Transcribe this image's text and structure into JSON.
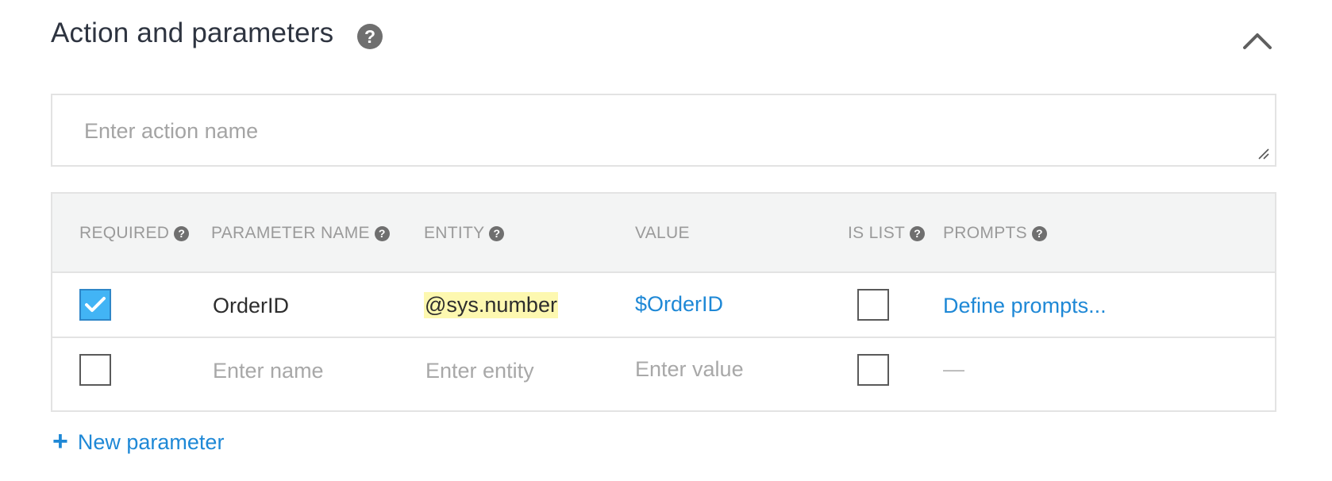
{
  "section": {
    "title": "Action and parameters",
    "help_icon": "?"
  },
  "action_input": {
    "placeholder": "Enter action name",
    "value": ""
  },
  "table": {
    "headers": {
      "required": "REQUIRED",
      "parameter_name": "PARAMETER NAME",
      "entity": "ENTITY",
      "value": "VALUE",
      "is_list": "IS LIST",
      "prompts": "PROMPTS"
    },
    "rows": [
      {
        "required": true,
        "parameter_name": "OrderID",
        "entity": "@sys.number",
        "value": "$OrderID",
        "is_list": false,
        "prompts": "Define prompts..."
      },
      {
        "required": false,
        "parameter_name_placeholder": "Enter name",
        "entity_placeholder": "Enter entity",
        "value_placeholder": "Enter value",
        "is_list": false,
        "prompts": "—"
      }
    ]
  },
  "new_parameter": {
    "plus": "+",
    "label": "New parameter"
  },
  "colors": {
    "link": "#1e88d6",
    "checkbox_checked": "#42b4f5",
    "entity_highlight": "#fdf8b0",
    "header_bg": "#f3f4f4"
  },
  "icons": {
    "help": "help-circle-icon",
    "collapse": "chevron-up-icon",
    "checkmark": "checkmark-icon",
    "resize": "resize-grip-icon",
    "add": "plus-icon"
  }
}
